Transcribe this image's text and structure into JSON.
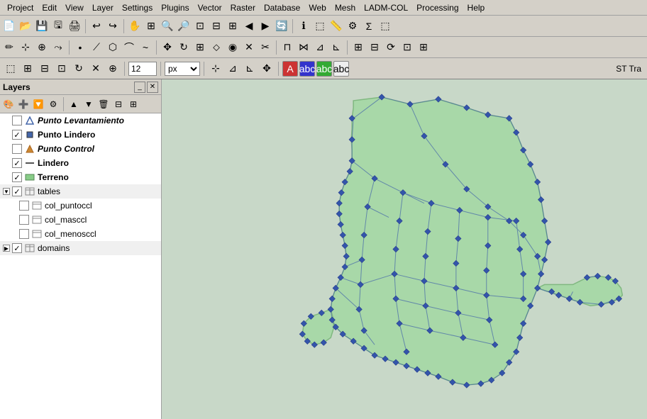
{
  "menubar": {
    "items": [
      "Project",
      "Edit",
      "View",
      "Layer",
      "Settings",
      "Plugins",
      "Vector",
      "Raster",
      "Database",
      "Web",
      "Mesh",
      "LADM-COL",
      "Processing",
      "Help"
    ]
  },
  "layers_panel": {
    "title": "Layers",
    "layers": [
      {
        "id": "punto-levantamiento",
        "indent": 1,
        "check": false,
        "icon": "diamond",
        "icon_color": "#4444aa",
        "name": "Punto Levantamiento",
        "bold": true,
        "italic": true
      },
      {
        "id": "punto-lindero",
        "indent": 1,
        "check": true,
        "icon": "circle",
        "icon_color": "#4444aa",
        "name": "Punto Lindero",
        "bold": true
      },
      {
        "id": "punto-control",
        "indent": 1,
        "check": false,
        "icon": "triangle",
        "icon_color": "#cc8833",
        "name": "Punto Control",
        "bold": true,
        "italic": true
      },
      {
        "id": "lindero",
        "indent": 1,
        "check": true,
        "icon": "line",
        "icon_color": "#555555",
        "name": "Lindero",
        "bold": true
      },
      {
        "id": "terreno",
        "indent": 1,
        "check": true,
        "icon": "rect",
        "icon_color": "#88cc88",
        "name": "Terreno",
        "bold": true
      },
      {
        "id": "tables",
        "indent": 0,
        "check": true,
        "expanded": true,
        "name": "tables",
        "is_group": true
      },
      {
        "id": "col-puntoccl",
        "indent": 2,
        "check": false,
        "icon": "table",
        "icon_color": "#888",
        "name": "col_puntoccl",
        "bold": false
      },
      {
        "id": "col-masccl",
        "indent": 2,
        "check": false,
        "icon": "table",
        "icon_color": "#888",
        "name": "col_masccl",
        "bold": false
      },
      {
        "id": "col-menosccl",
        "indent": 2,
        "check": false,
        "icon": "table",
        "icon_color": "#888",
        "name": "col_menosccl",
        "bold": false
      },
      {
        "id": "domains",
        "indent": 0,
        "check": true,
        "expanded": false,
        "name": "domains",
        "is_group": true
      }
    ]
  },
  "toolbar": {
    "font_size": "12",
    "font_unit": "px"
  },
  "map": {
    "bg_color": "#c8d8c8"
  }
}
